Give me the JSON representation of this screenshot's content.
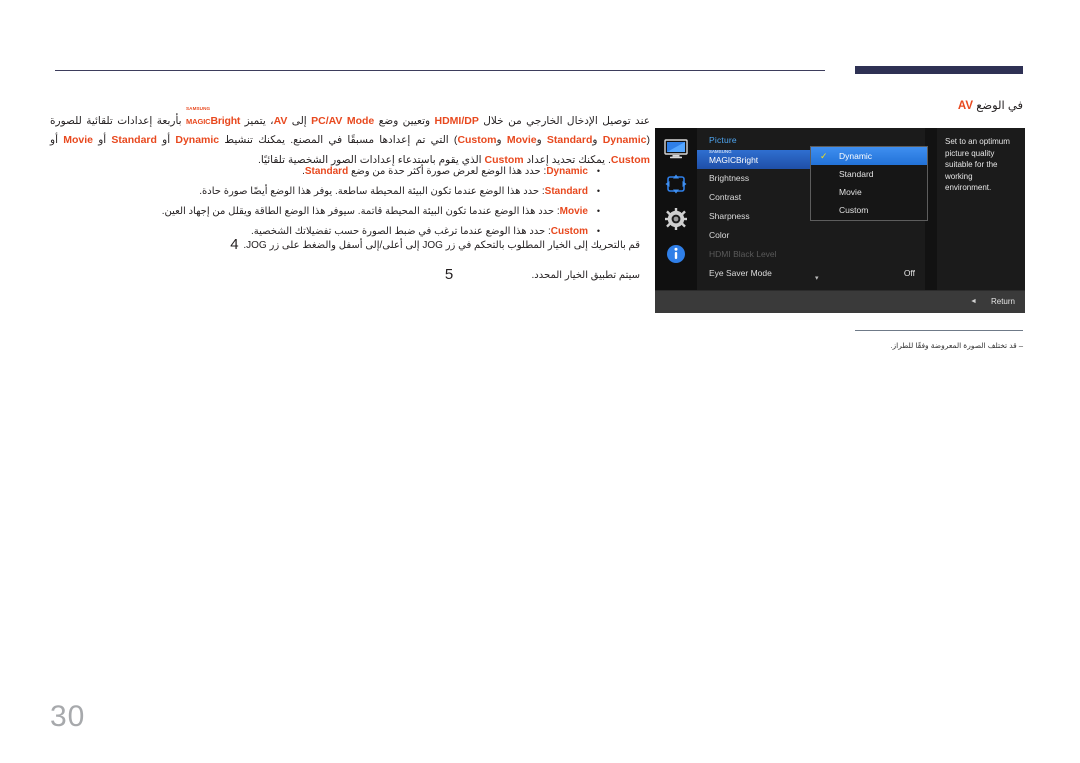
{
  "page": {
    "number": "30"
  },
  "header": {
    "title_prefix": "في الوضع ",
    "title_highlight": "AV"
  },
  "intro": {
    "line1_a": "عند توصيل الإدخال الخارجي من خلال ",
    "line1_hdmi": "HDMI/DP",
    "line1_b": " وتعيين وضع ",
    "line1_pcav": "PC/AV Mode",
    "line1_c": " إلى ",
    "line1_av": "AV",
    "line1_d": "، يتميز ",
    "magic_samsung": "SAMSUNG",
    "magic_magic": "MAGIC",
    "magic_bright": "Bright",
    "line1_e": " بأربعة إعدادات تلقائية للصورة (",
    "opt_dynamic": "Dynamic",
    "line1_f": " و",
    "opt_standard": "Standard",
    "line1_g": " و",
    "opt_movie": "Movie",
    "line1_h": " و",
    "opt_custom": "Custom",
    "line1_i": ") التي تم إعدادها مسبقًا في المصنع. يمكنك تنشيط ",
    "line1_j": " أو ",
    "line1_k": " أو ",
    "line1_l": " أو ",
    "line1_m": ". يمكنك تحديد إعداد ",
    "line1_n": " الذي يقوم باستدعاء إعدادات الصور الشخصية تلقائيًا."
  },
  "bullets": [
    {
      "term": "Dynamic",
      "text_a": ": حدد هذا الوضع لعرض صورة أكثر حدة من وضع ",
      "term2": "Standard",
      "text_b": "."
    },
    {
      "term": "Standard",
      "text_a": ": حدد هذا الوضع عندما تكون البيئة المحيطة ساطعة. يوفر هذا الوضع أيضًا صورة حادة.",
      "term2": "",
      "text_b": ""
    },
    {
      "term": "Movie",
      "text_a": ": حدد هذا الوضع عندما تكون البيئة المحيطة قاتمة. سيوفر هذا الوضع الطاقة ويقلل من إجهاد العين.",
      "term2": "",
      "text_b": ""
    },
    {
      "term": "Custom",
      "text_a": ": حدد هذا الوضع عندما ترغب في ضبط الصورة حسب تفضيلاتك الشخصية.",
      "term2": "",
      "text_b": ""
    }
  ],
  "steps": [
    {
      "number": "4",
      "text": "قم بالتحريك إلى الخيار المطلوب بالتحكم في زر JOG إلى أعلى/إلى أسفل والضغط على زر JOG."
    },
    {
      "number": "5",
      "text": "سيتم تطبيق الخيار المحدد."
    }
  ],
  "footnote": {
    "text": "‒ قد تختلف الصورة المعروضة وفقًا للطراز."
  },
  "osd": {
    "menu_title": "Picture",
    "rail_icons": [
      "monitor-icon",
      "move-arrows-icon",
      "gear-icon",
      "info-icon"
    ],
    "items": [
      {
        "label_type": "magic",
        "samsung": "SAMSUNG",
        "magic": "MAGIC",
        "bright": "Bright",
        "value": "",
        "selected": true,
        "disabled": false
      },
      {
        "label_type": "text",
        "label": "Brightness",
        "value": "",
        "selected": false,
        "disabled": false
      },
      {
        "label_type": "text",
        "label": "Contrast",
        "value": "",
        "selected": false,
        "disabled": false
      },
      {
        "label_type": "text",
        "label": "Sharpness",
        "value": "",
        "selected": false,
        "disabled": false
      },
      {
        "label_type": "text",
        "label": "Color",
        "value": "",
        "selected": false,
        "disabled": false
      },
      {
        "label_type": "text",
        "label": "HDMI Black Level",
        "value": "",
        "selected": false,
        "disabled": true
      },
      {
        "label_type": "text",
        "label": "Eye Saver Mode",
        "value": "Off",
        "selected": false,
        "disabled": false
      }
    ],
    "scroll_chevron": "▾",
    "submenu": [
      {
        "label": "Dynamic",
        "checked": true,
        "selected": true
      },
      {
        "label": "Standard",
        "checked": false,
        "selected": false
      },
      {
        "label": "Movie",
        "checked": false,
        "selected": false
      },
      {
        "label": "Custom",
        "checked": false,
        "selected": false
      }
    ],
    "check_glyph": "✓",
    "description": "Set to an optimum picture quality suitable for the working environment.",
    "return_label": "Return",
    "return_arrow": "◄",
    "colors": {
      "highlight_blue": "#2f6fd0",
      "submenu_blue": "#3f8ff0",
      "check_yellow": "#f2e11a",
      "title_blue": "#4fa8f5",
      "panel_bg": "#1b1b1b",
      "bottom_bar": "#3a3a3a"
    }
  },
  "doc_colors": {
    "accent_orange": "#e8491f",
    "rule_navy": "#2e3154",
    "page_number_gray": "#a7a9ac"
  }
}
